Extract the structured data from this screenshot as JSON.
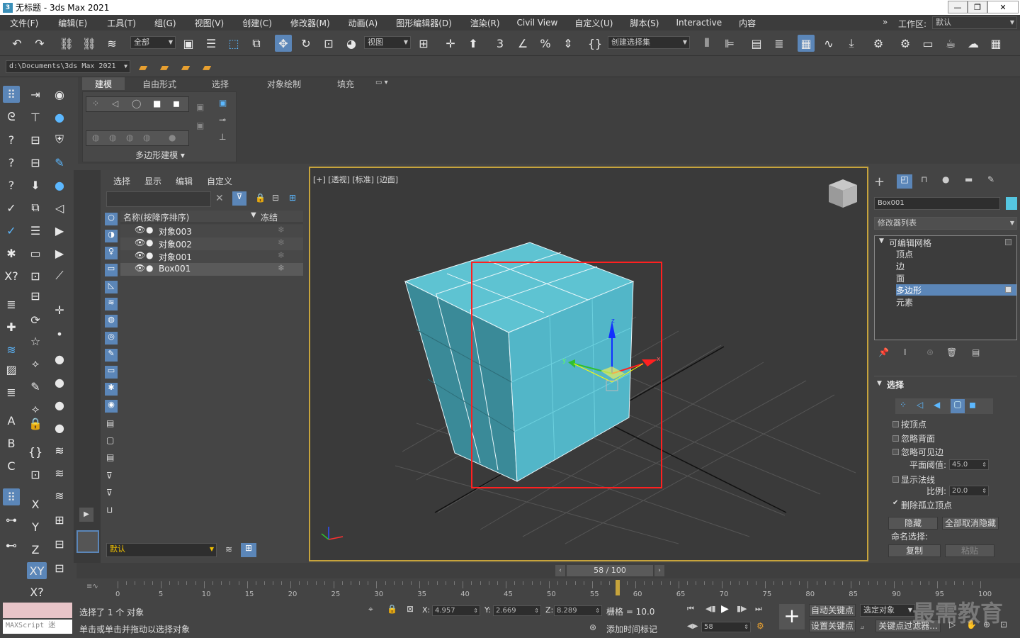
{
  "window": {
    "title": "无标题 - 3ds Max 2021",
    "logo": "3"
  },
  "menu": [
    "文件(F)",
    "编辑(E)",
    "工具(T)",
    "组(G)",
    "视图(V)",
    "创建(C)",
    "修改器(M)",
    "动画(A)",
    "图形编辑器(D)",
    "渲染(R)",
    "Civil View",
    "自定义(U)",
    "脚本(S)",
    "Interactive",
    "内容"
  ],
  "workspace": {
    "label": "工作区:",
    "value": "默认"
  },
  "toolbar1": {
    "filter": "全部",
    "ref_coord": "视图",
    "named_sel": "创建选择集"
  },
  "toolbar2": {
    "path": "d:\\Documents\\3ds Max 2021"
  },
  "ribbon": {
    "tabs": [
      "建模",
      "自由形式",
      "选择",
      "对象绘制",
      "填充"
    ],
    "active_tab": "建模",
    "section": "多边形建模 ▾"
  },
  "scene_explorer": {
    "tabs": [
      "选择",
      "显示",
      "编辑",
      "自定义"
    ],
    "col_name": "名称(按降序排序)",
    "col_freeze": "冻结",
    "rows": [
      {
        "name": "对象003"
      },
      {
        "name": "对象002"
      },
      {
        "name": "对象001"
      },
      {
        "name": "Box001"
      }
    ],
    "layer": "默认"
  },
  "viewport": {
    "label": "[+] [透视] [标准] [边面]",
    "axis_x": "x",
    "axis_y": "y",
    "axis_z": "z",
    "colors": {
      "box_fill": "#5bbccc",
      "highlight": "#ff2020"
    }
  },
  "command_panel": {
    "object_name": "Box001",
    "object_color": "#55c6e0",
    "modifier_list": "修改器列表",
    "stack": [
      {
        "label": "可编辑网格",
        "level": 0
      },
      {
        "label": "顶点",
        "level": 1
      },
      {
        "label": "边",
        "level": 1
      },
      {
        "label": "面",
        "level": 1
      },
      {
        "label": "多边形",
        "level": 1,
        "selected": true
      },
      {
        "label": "元素",
        "level": 1
      }
    ],
    "rollout_title": "选择",
    "checks": [
      "按顶点",
      "忽略背面",
      "忽略可见边"
    ],
    "plane_threshold_label": "平面阈值:",
    "plane_threshold": "45.0",
    "show_normals": "显示法线",
    "scale_label": "比例:",
    "scale": "20.0",
    "delete_isolated": "删除孤立顶点",
    "hide": "隐藏",
    "unhide_all": "全部取消隐藏",
    "named_sel_label": "命名选择:",
    "copy": "复制",
    "paste": "粘贴"
  },
  "timeline": {
    "frame_display": "58 / 100",
    "current": 58,
    "max": 100,
    "ticks": [
      "0",
      "5",
      "10",
      "15",
      "20",
      "25",
      "30",
      "35",
      "40",
      "45",
      "50",
      "55",
      "60",
      "65",
      "70",
      "75",
      "80",
      "85",
      "90",
      "95",
      "100"
    ]
  },
  "status": {
    "maxscript": "MAXScript 迷",
    "selected": "选择了 1 个 对象",
    "hint": "单击或单击并拖动以选择对象",
    "x_label": "X:",
    "x": "4.957",
    "y_label": "Y:",
    "y": "2.669",
    "z_label": "Z:",
    "z": "8.289",
    "grid": "栅格 = 10.0",
    "add_tag": "添加时间标记",
    "auto_key": "自动关键点",
    "sel_obj": "选定对象",
    "set_key": "设置关键点",
    "key_filter": "关键点过滤器...",
    "frame": "58",
    "watermark": "最需教育"
  }
}
